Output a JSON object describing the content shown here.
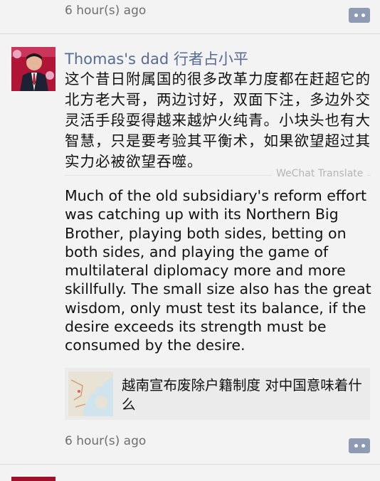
{
  "prev_post": {
    "time": "6 hour(s) ago",
    "more_icon": "more-dots-icon"
  },
  "post": {
    "author": "Thomas's dad 行者占小平",
    "avatar_icon": "avatar-photo",
    "text_zh": "这个昔日附属国的很多改革力度都在赶超它的北方老大哥，两边讨好，双面下注，多边外交灵活手段耍得越来越炉火纯青。小块头也有大智慧，只是要考验其平衡术，如果欲望超过其实力必被欲望吞噬。",
    "translate_label": "WeChat Translate",
    "text_en": "Much of the old subsidiary's reform effort was catching up with its Northern Big Brother, playing both sides, betting on both sides, and playing the game of multilateral diplomacy more and more skillfully. The small size also has the great wisdom, only must test its balance, if the desire exceeds its strength must be consumed by the desire.",
    "link": {
      "title": "越南宣布废除户籍制度 对中国意味着什么",
      "thumb_icon": "map-thumbnail"
    },
    "time": "6 hour(s) ago",
    "more_icon": "more-dots-icon"
  },
  "colors": {
    "author": "#576b95",
    "more_button": "#8f9bb3",
    "background": "#f3f3f3",
    "link_card": "#ebebeb"
  }
}
